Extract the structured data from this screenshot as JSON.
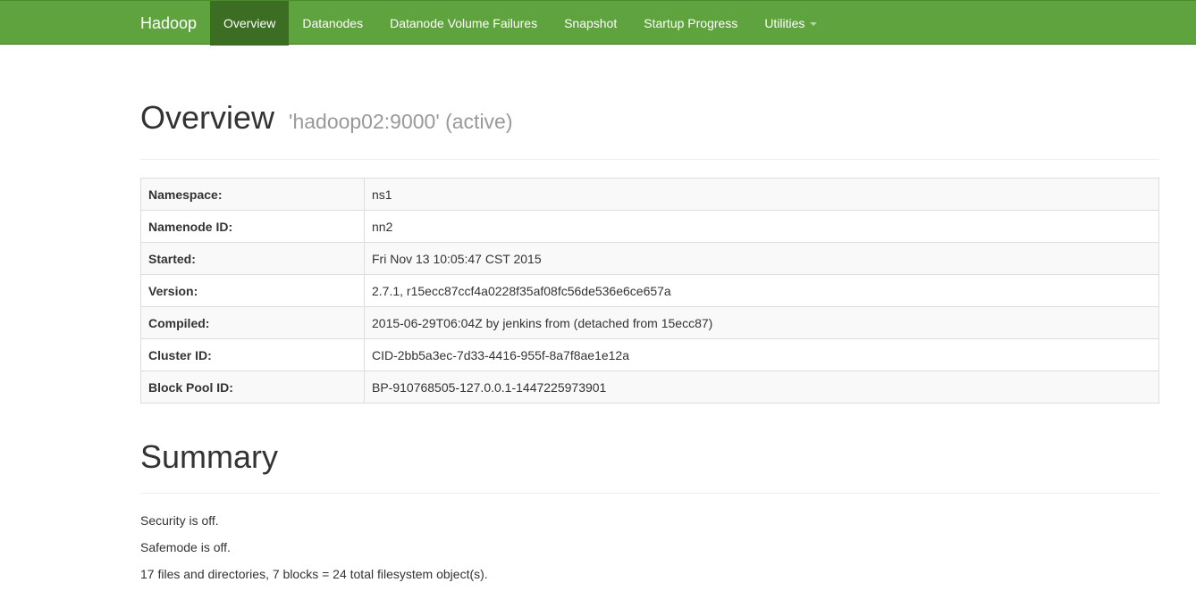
{
  "navbar": {
    "brand": "Hadoop",
    "items": [
      {
        "label": "Overview"
      },
      {
        "label": "Datanodes"
      },
      {
        "label": "Datanode Volume Failures"
      },
      {
        "label": "Snapshot"
      },
      {
        "label": "Startup Progress"
      },
      {
        "label": "Utilities"
      }
    ],
    "bg_color": "#5fa33e",
    "active_color": "#3b6e22"
  },
  "overview": {
    "title": "Overview",
    "subtitle": "'hadoop02:9000' (active)",
    "rows": [
      {
        "key": "Namespace:",
        "value": "ns1"
      },
      {
        "key": "Namenode ID:",
        "value": "nn2"
      },
      {
        "key": "Started:",
        "value": "Fri Nov 13 10:05:47 CST 2015"
      },
      {
        "key": "Version:",
        "value": "2.7.1, r15ecc87ccf4a0228f35af08fc56de536e6ce657a"
      },
      {
        "key": "Compiled:",
        "value": "2015-06-29T06:04Z by jenkins from (detached from 15ecc87)"
      },
      {
        "key": "Cluster ID:",
        "value": "CID-2bb5a3ec-7d33-4416-955f-8a7f8ae1e12a"
      },
      {
        "key": "Block Pool ID:",
        "value": "BP-910768505-127.0.0.1-1447225973901"
      }
    ]
  },
  "summary": {
    "title": "Summary",
    "lines": [
      "Security is off.",
      "Safemode is off.",
      "17 files and directories, 7 blocks = 24 total filesystem object(s)."
    ]
  }
}
